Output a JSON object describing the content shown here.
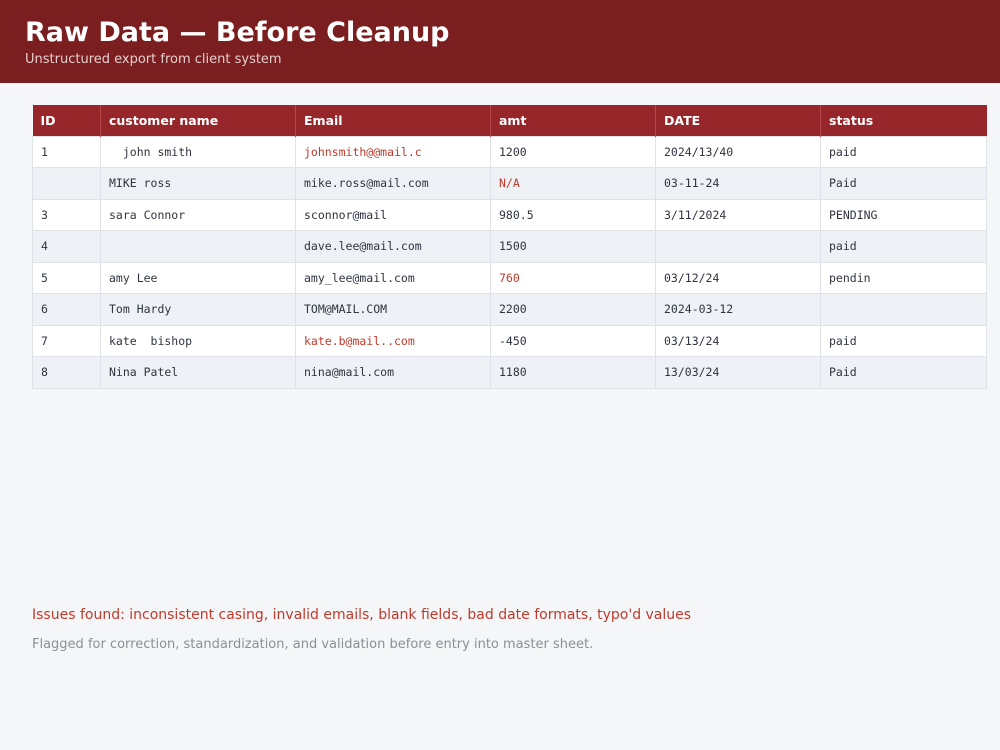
{
  "header": {
    "title": "Raw Data — Before Cleanup",
    "subtitle": "Unstructured export from client system"
  },
  "table": {
    "columns": [
      "ID",
      "customer name",
      "Email",
      "amt",
      "DATE",
      "status"
    ],
    "rows": [
      [
        "1",
        "  john smith",
        "johnsmith@@mail.c",
        "1200",
        "2024/13/40",
        "paid"
      ],
      [
        "",
        "MIKE ross",
        "mike.ross@mail.com",
        "N/A",
        "03-11-24",
        "Paid"
      ],
      [
        "3",
        "sara Connor",
        "sconnor@mail",
        "980.5",
        "3/11/2024",
        "PENDING"
      ],
      [
        "4",
        "",
        "dave.lee@mail.com",
        "1500",
        "",
        "paid"
      ],
      [
        "5",
        "amy Lee",
        "amy_lee@mail.com",
        "760",
        "03/12/24",
        "pendin"
      ],
      [
        "6",
        "Tom Hardy",
        "TOM@MAIL.COM",
        "2200",
        "2024-03-12",
        ""
      ],
      [
        "7",
        "kate  bishop",
        "kate.b@mail..com",
        "-450",
        "03/13/24",
        "paid"
      ],
      [
        "8",
        "Nina Patel",
        "nina@mail.com",
        "1180",
        "13/03/24",
        "Paid"
      ]
    ],
    "error_cells": [
      [
        0,
        2
      ],
      [
        1,
        3
      ],
      [
        4,
        3
      ],
      [
        6,
        2
      ]
    ]
  },
  "footer": {
    "issues": "Issues found: inconsistent casing, invalid emails, blank fields, bad date formats, typo'd values",
    "note": "Flagged for correction, standardization, and validation before entry into master sheet."
  },
  "colors": {
    "header_bg": "#7a1e1f",
    "table_header_bg": "#96262a",
    "error_text": "#c0392b",
    "muted_text": "#8a8f98"
  }
}
